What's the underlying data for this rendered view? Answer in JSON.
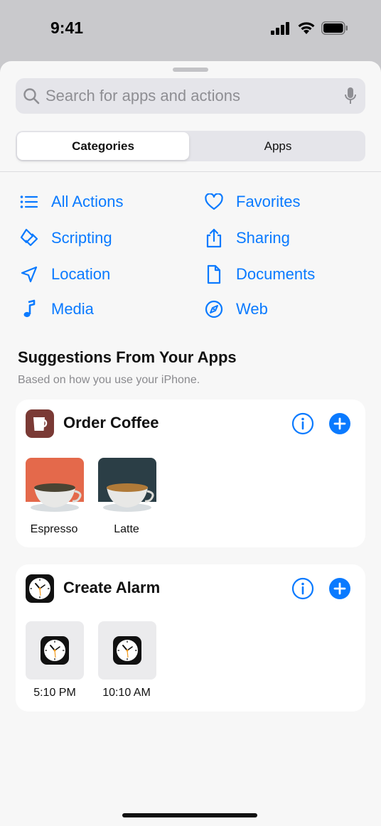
{
  "status": {
    "time": "9:41"
  },
  "search": {
    "placeholder": "Search for apps and actions"
  },
  "segments": {
    "categories": "Categories",
    "apps": "Apps"
  },
  "categories": [
    {
      "label": "All Actions",
      "icon": "list-icon"
    },
    {
      "label": "Favorites",
      "icon": "heart-icon"
    },
    {
      "label": "Scripting",
      "icon": "scripting-icon"
    },
    {
      "label": "Sharing",
      "icon": "share-icon"
    },
    {
      "label": "Location",
      "icon": "location-arrow-icon"
    },
    {
      "label": "Documents",
      "icon": "document-icon"
    },
    {
      "label": "Media",
      "icon": "music-note-icon"
    },
    {
      "label": "Web",
      "icon": "compass-icon"
    }
  ],
  "suggestions": {
    "title": "Suggestions From Your Apps",
    "subtitle": "Based on how you use your iPhone."
  },
  "cards": [
    {
      "title": "Order Coffee",
      "app_icon": "coffee-cup-icon",
      "items": [
        {
          "label": "Espresso",
          "color": "#e4694b"
        },
        {
          "label": "Latte",
          "color": "#2b3e46"
        }
      ]
    },
    {
      "title": "Create Alarm",
      "app_icon": "clock-icon",
      "items": [
        {
          "label": "5:10 PM"
        },
        {
          "label": "10:10 AM"
        }
      ]
    }
  ],
  "colors": {
    "accent": "#0a7aff",
    "sheet": "#f7f7f7",
    "coffee_app": "#7a3a35"
  }
}
